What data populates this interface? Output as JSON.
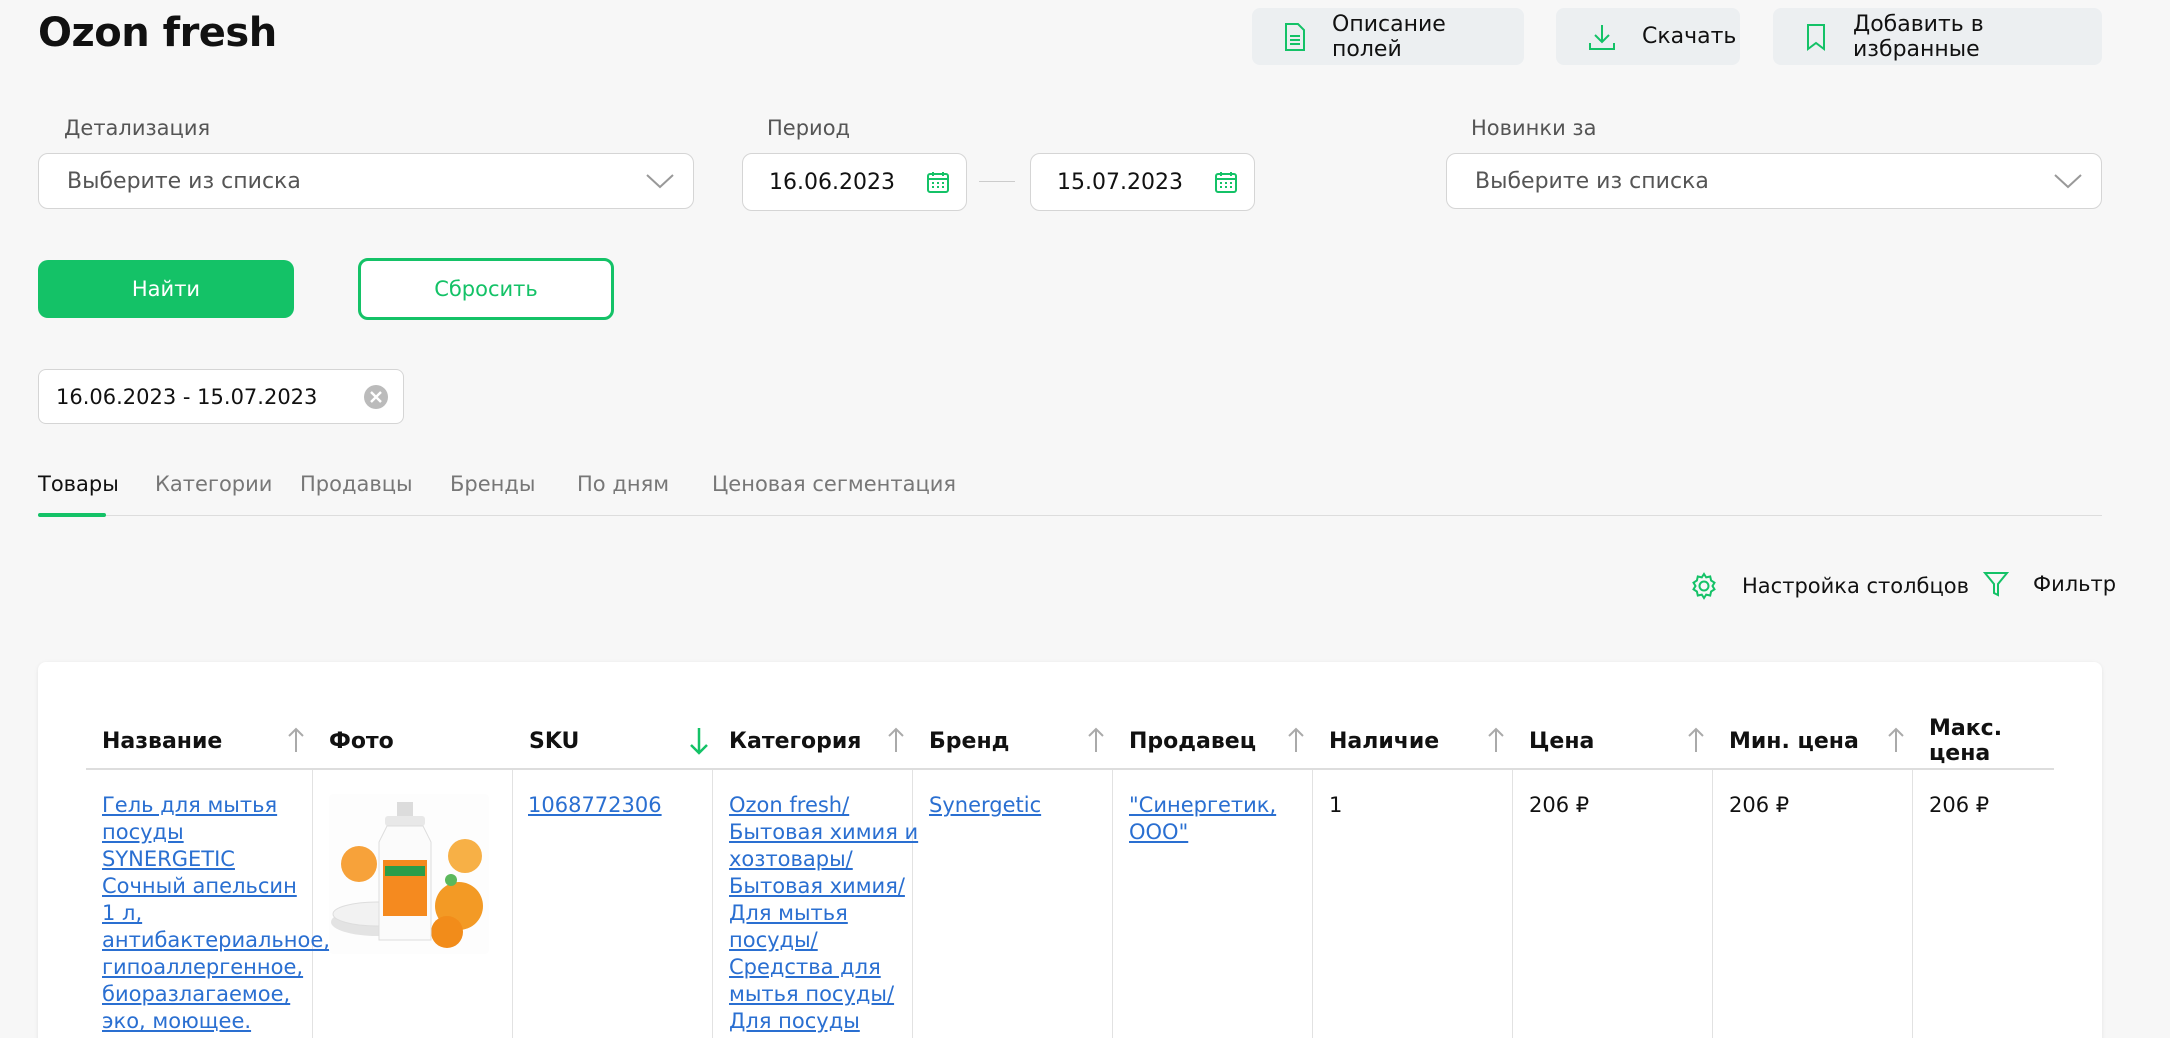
{
  "header": {
    "title": "Ozon fresh",
    "buttons": {
      "fields_description": "Описание полей",
      "download": "Скачать",
      "add_favorites": "Добавить в избранные"
    }
  },
  "filters": {
    "detail": {
      "label": "Детализация",
      "placeholder": "Выберите из списка"
    },
    "period": {
      "label": "Период",
      "from": "16.06.2023",
      "to": "15.07.2023"
    },
    "new_for": {
      "label": "Новинки за",
      "placeholder": "Выберите из списка"
    },
    "find_label": "Найти",
    "reset_label": "Сбросить",
    "active_chip": "16.06.2023 - 15.07.2023"
  },
  "tabs": [
    {
      "label": "Товары",
      "active": true
    },
    {
      "label": "Категории"
    },
    {
      "label": "Продавцы"
    },
    {
      "label": "Бренды"
    },
    {
      "label": "По дням"
    },
    {
      "label": "Ценовая сегментация"
    }
  ],
  "tools": {
    "columns_settings": "Настройка столбцов",
    "filter": "Фильтр"
  },
  "table": {
    "columns": [
      "Название",
      "Фото",
      "SKU",
      "Категория",
      "Бренд",
      "Продавец",
      "Наличие",
      "Цена",
      "Мин. цена",
      "Макс. цена"
    ],
    "rows": [
      {
        "name_lines": [
          "Гель для мытья",
          "посуды",
          "SYNERGETIC",
          "Сочный апельсин",
          "1 л,",
          "антибактериальное,",
          "гипоаллергенное,",
          "биоразлагаемое,",
          "эко, моющее."
        ],
        "sku": "1068772306",
        "category_lines": [
          "Ozon fresh/",
          "Бытовая химия и",
          "хозтовары/",
          "Бытовая химия/",
          "Для мытья",
          "посуды/",
          "Средства для",
          "мытья посуды/",
          "Для посуды"
        ],
        "brand": "Synergetic",
        "seller_lines": [
          "\"Синергетик,",
          "ООО\""
        ],
        "stock": "1",
        "price": "206 ₽",
        "min_price": "206 ₽",
        "max_price": "206 ₽"
      }
    ]
  },
  "colors": {
    "accent": "#14c267",
    "link": "#2a6fd1"
  }
}
